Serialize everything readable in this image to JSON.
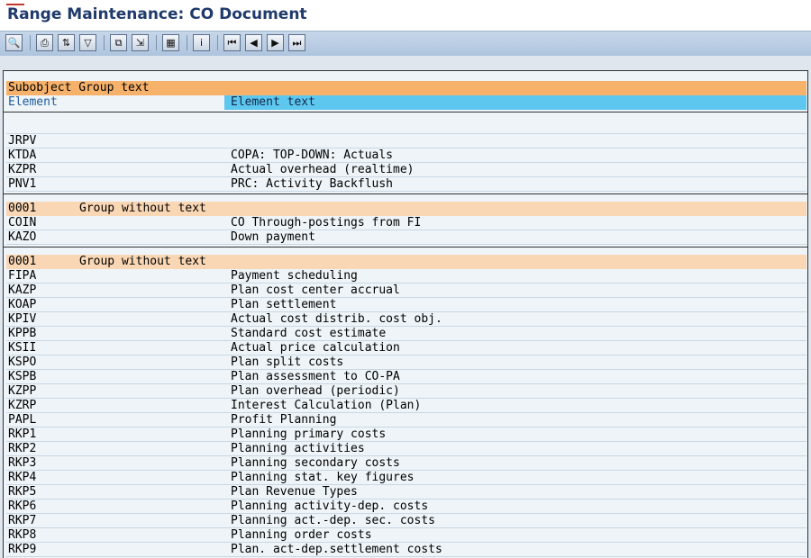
{
  "window": {
    "title": "Range Maintenance: CO Document"
  },
  "toolbar": {
    "buttons": [
      {
        "name": "find-icon",
        "glyph": "🔍"
      },
      {
        "name": "print-icon",
        "glyph": "⎙"
      },
      {
        "name": "sort-icon",
        "glyph": "⇅"
      },
      {
        "name": "filter-icon",
        "glyph": "▽"
      },
      {
        "name": "export-icon",
        "glyph": "⧉"
      },
      {
        "name": "local-file-icon",
        "glyph": "⇲"
      },
      {
        "name": "layout-icon",
        "glyph": "▦"
      },
      {
        "name": "info-icon",
        "glyph": "i"
      },
      {
        "name": "first-page-icon",
        "glyph": "⏮"
      },
      {
        "name": "previous-page-icon",
        "glyph": "◀"
      },
      {
        "name": "next-page-icon",
        "glyph": "▶"
      },
      {
        "name": "last-page-icon",
        "glyph": "⏭"
      }
    ]
  },
  "list": {
    "header": {
      "group_label": "Subobject Group text",
      "element_label": "Element",
      "element_text_label": "Element text"
    },
    "groups": [
      {
        "key": "",
        "text": "",
        "rows": [
          {
            "code": "JRPV",
            "text": ""
          },
          {
            "code": "KTDA",
            "text": "COPA: TOP-DOWN: Actuals"
          },
          {
            "code": "KZPR",
            "text": "Actual overhead (realtime)"
          },
          {
            "code": "PNV1",
            "text": "PRC: Activity Backflush"
          }
        ]
      },
      {
        "key": "0001",
        "text": "Group without text",
        "rows": [
          {
            "code": "COIN",
            "text": "CO Through-postings from FI"
          },
          {
            "code": "KAZO",
            "text": "Down payment"
          }
        ]
      },
      {
        "key": "0001",
        "text": "Group without text",
        "rows": [
          {
            "code": "FIPA",
            "text": "Payment scheduling"
          },
          {
            "code": "KAZP",
            "text": "Plan cost center accrual"
          },
          {
            "code": "KOAP",
            "text": "Plan settlement"
          },
          {
            "code": "KPIV",
            "text": "Actual cost distrib. cost obj."
          },
          {
            "code": "KPPB",
            "text": "Standard cost estimate"
          },
          {
            "code": "KSII",
            "text": "Actual price calculation"
          },
          {
            "code": "KSPO",
            "text": "Plan split costs"
          },
          {
            "code": "KSPB",
            "text": "Plan assessment to CO-PA"
          },
          {
            "code": "KZPP",
            "text": "Plan overhead (periodic)"
          },
          {
            "code": "KZRP",
            "text": "Interest Calculation (Plan)"
          },
          {
            "code": "PAPL",
            "text": "Profit Planning"
          },
          {
            "code": "RKP1",
            "text": "Planning primary costs"
          },
          {
            "code": "RKP2",
            "text": "Planning activities"
          },
          {
            "code": "RKP3",
            "text": "Planning secondary costs"
          },
          {
            "code": "RKP4",
            "text": "Planning stat. key figures"
          },
          {
            "code": "RKP5",
            "text": "Plan Revenue Types"
          },
          {
            "code": "RKP6",
            "text": "Planning activity-dep. costs"
          },
          {
            "code": "RKP7",
            "text": "Planning act.-dep. sec. costs"
          },
          {
            "code": "RKP8",
            "text": "Planning order costs"
          },
          {
            "code": "RKP9",
            "text": "Plan. act-dep.settlement costs"
          }
        ]
      }
    ]
  },
  "colors": {
    "group_header": "#f6b26b",
    "group_row": "#fad7b4",
    "column_highlight": "#5ec7ef",
    "title": "#1f3a6b"
  }
}
